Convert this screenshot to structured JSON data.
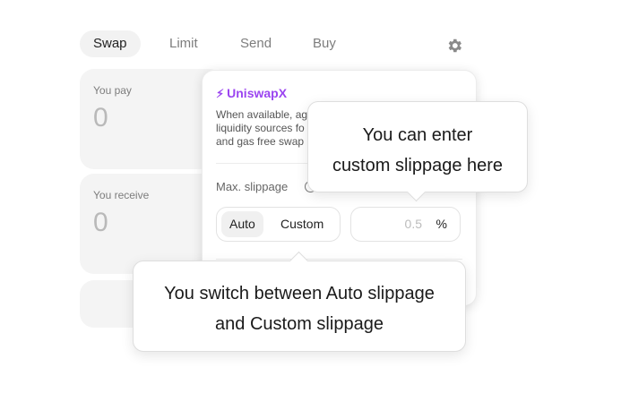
{
  "tabs": [
    "Swap",
    "Limit",
    "Send",
    "Buy"
  ],
  "icons": {
    "settings": "gear-icon",
    "uniswapx": "bolt-icon",
    "info": "info-icon"
  },
  "you_pay": {
    "label": "You pay",
    "value": "0"
  },
  "you_receive": {
    "label": "You receive",
    "value": "0"
  },
  "settings": {
    "uniswapx_title": "UniswapX",
    "uniswapx_desc": [
      "When available, ag",
      "liquidity sources fo",
      "and gas free swap"
    ],
    "max_slippage_label": "Max. slippage",
    "mode_auto": "Auto",
    "mode_custom": "Custom",
    "slippage_placeholder": "0.5",
    "slippage_unit": "%"
  },
  "callouts": {
    "custom": [
      "You can enter",
      "custom slippage here"
    ],
    "switch": [
      "You switch between Auto slippage",
      "and Custom slippage"
    ]
  },
  "colors": {
    "accent": "#9b45f0",
    "panel_bg": "#f4f4f4"
  }
}
